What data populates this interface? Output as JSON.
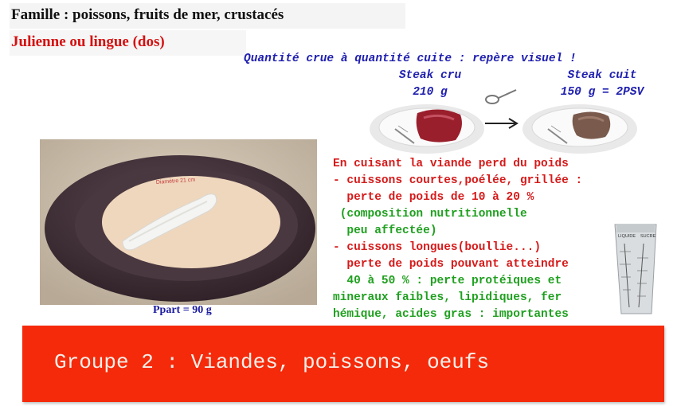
{
  "header": {
    "family": "Famille : poissons, fruits de mer, crustacés",
    "fish_name": "Julienne ou lingue (dos)"
  },
  "visual_guide": {
    "title": "Quantité crue à quantité cuite : repère visuel !",
    "raw_label": "Steak cru",
    "raw_weight": "210 g",
    "cooked_label": "Steak cuit",
    "cooked_weight": "150 g = 2PSV"
  },
  "plate": {
    "rim_text": "Diamètre 21 cm",
    "portion": "Ppart = 90 g"
  },
  "notes": [
    {
      "text": "En cuisant la viande perd du poids",
      "color": "red"
    },
    {
      "text": "- cuissons courtes,poélée, grillée :",
      "color": "red"
    },
    {
      "text": "  perte de poids de 10 à 20 %",
      "color": "red"
    },
    {
      "text": " (composition nutritionnelle",
      "color": "green"
    },
    {
      "text": "  peu affectée)",
      "color": "green"
    },
    {
      "text": "- cuissons longues(boullie...)",
      "color": "red"
    },
    {
      "text": "  perte de poids pouvant atteindre",
      "color": "red"
    },
    {
      "text": "  40 à 50 % : perte protéiques et",
      "color": "green"
    },
    {
      "text": "mineraux faibles, lipidiques, fer",
      "color": "green"
    },
    {
      "text": "hémique, acides gras : importantes",
      "color": "green"
    }
  ],
  "measure_cup": {
    "left_label": "LIQUIDE",
    "right_label": "SUCRE"
  },
  "banner": {
    "text": "Groupe 2 : Viandes, poissons, oeufs"
  }
}
